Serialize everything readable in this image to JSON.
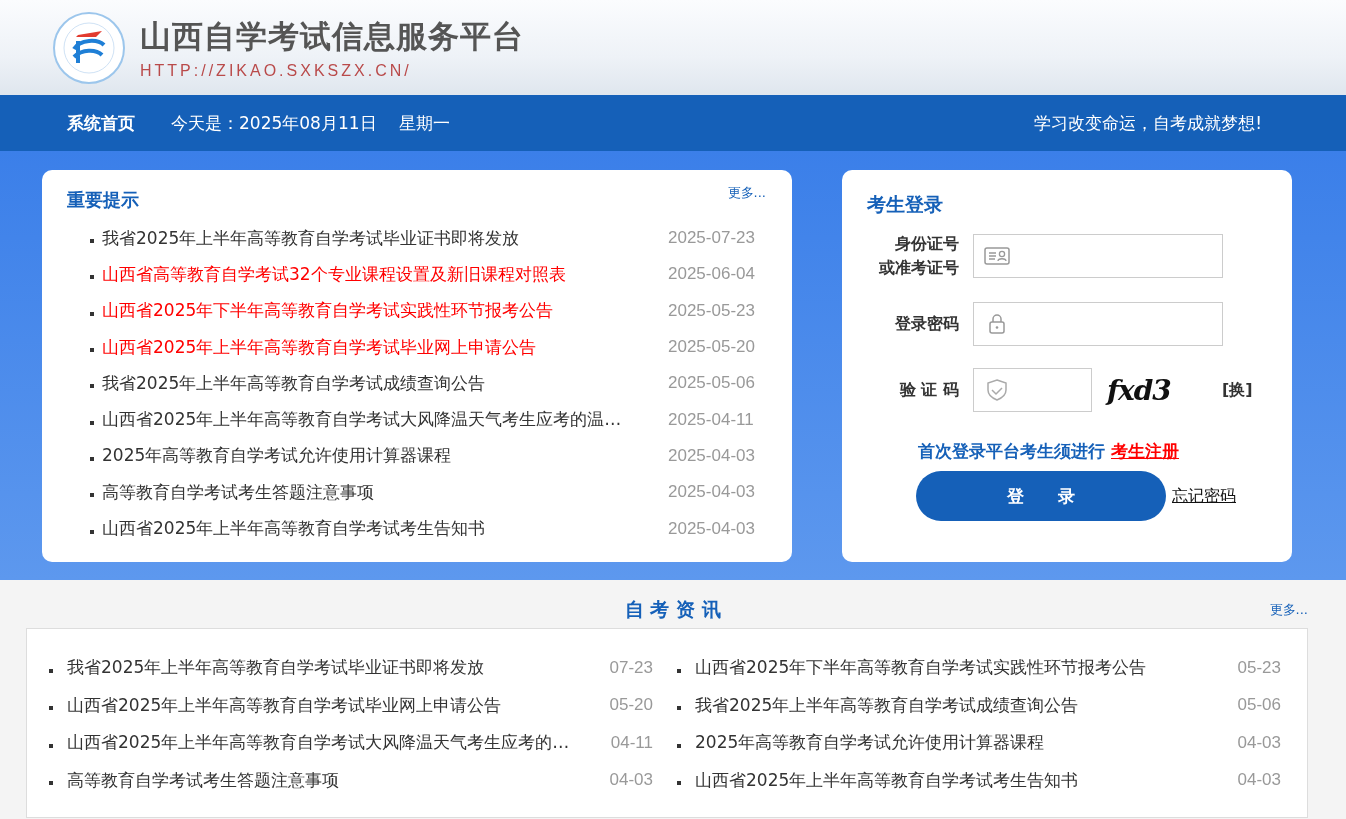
{
  "header": {
    "title": "山西自学考试信息服务平台",
    "url": "HTTP://ZIKAO.SXKSZX.CN/"
  },
  "nav": {
    "home": "系统首页",
    "date_label": "今天是：2025年08月11日",
    "weekday": "星期一",
    "slogan": "学习改变命运，自考成就梦想!"
  },
  "notices": {
    "title": "重要提示",
    "more": "更多...",
    "items": [
      {
        "text": "我省2025年上半年高等教育自学考试毕业证书即将发放",
        "date": "2025-07-23",
        "highlighted": false
      },
      {
        "text": "山西省高等教育自学考试32个专业课程设置及新旧课程对照表",
        "date": "2025-06-04",
        "highlighted": true
      },
      {
        "text": "山西省2025年下半年高等教育自学考试实践性环节报考公告",
        "date": "2025-05-23",
        "highlighted": true
      },
      {
        "text": "山西省2025年上半年高等教育自学考试毕业网上申请公告",
        "date": "2025-05-20",
        "highlighted": true
      },
      {
        "text": "我省2025年上半年高等教育自学考试成绩查询公告",
        "date": "2025-05-06",
        "highlighted": false
      },
      {
        "text": "山西省2025年上半年高等教育自学考试大风降温天气考生应考的温…",
        "date": "2025-04-11",
        "highlighted": false
      },
      {
        "text": "2025年高等教育自学考试允许使用计算器课程",
        "date": "2025-04-03",
        "highlighted": false
      },
      {
        "text": "高等教育自学考试考生答题注意事项",
        "date": "2025-04-03",
        "highlighted": false
      },
      {
        "text": "山西省2025年上半年高等教育自学考试考生告知书",
        "date": "2025-04-03",
        "highlighted": false
      }
    ]
  },
  "login": {
    "title": "考生登录",
    "id_label_1": "身份证号",
    "id_label_2": "或准考证号",
    "password_label": "登录密码",
    "captcha_label": "验 证 码",
    "captcha_text": "fxd3",
    "refresh": "[换]",
    "register_prompt": "首次登录平台考生须进行",
    "register_link": "考生注册",
    "submit": "登　　录",
    "forgot": "忘记密码"
  },
  "news": {
    "title": "自 考 资 讯",
    "more": "更多...",
    "columns": [
      [
        {
          "text": "我省2025年上半年高等教育自学考试毕业证书即将发放",
          "date": "07-23"
        },
        {
          "text": "山西省2025年上半年高等教育自学考试毕业网上申请公告",
          "date": "05-20"
        },
        {
          "text": "山西省2025年上半年高等教育自学考试大风降温天气考生应考的…",
          "date": "04-11"
        },
        {
          "text": "高等教育自学考试考生答题注意事项",
          "date": "04-03"
        }
      ],
      [
        {
          "text": "山西省2025年下半年高等教育自学考试实践性环节报考公告",
          "date": "05-23"
        },
        {
          "text": "我省2025年上半年高等教育自学考试成绩查询公告",
          "date": "05-06"
        },
        {
          "text": "2025年高等教育自学考试允许使用计算器课程",
          "date": "04-03"
        },
        {
          "text": "山西省2025年上半年高等教育自学考试考生告知书",
          "date": "04-03"
        }
      ]
    ]
  }
}
